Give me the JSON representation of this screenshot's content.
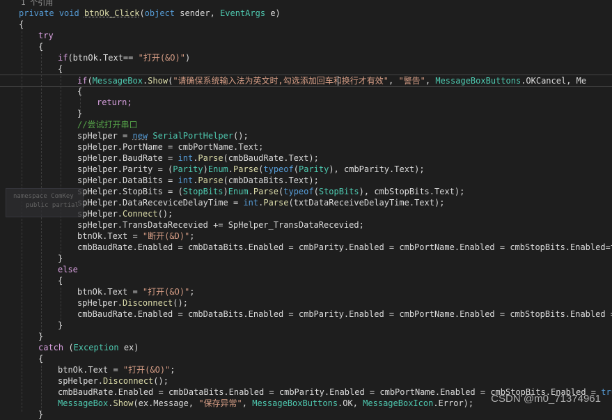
{
  "editor": {
    "codelens": "1 个引用",
    "sig": {
      "kw1": "private",
      "kw2": "void",
      "name": "btnOk_Click",
      "p1": "(",
      "t1": "object",
      "p2": " sender, ",
      "t2": "EventArgs",
      "p3": " e)"
    },
    "ob1": "{",
    "try": "try",
    "ob2": "{",
    "if1": {
      "kw": "if",
      "a": "(btnOk.Text== ",
      "s": "\"打开(&O)\"",
      "b": ")"
    },
    "ob3": "{",
    "if2": {
      "kw": "if",
      "a": "(",
      "cls": "MessageBox",
      "dot": ".",
      "m": "Show",
      "b": "(",
      "s1": "\"请确保系统输入法为英文时,勾选添加回车和换行才有效\"",
      "c": ", ",
      "s2": "\"警告\"",
      "d": ", ",
      "cls2": "MessageBoxButtons",
      "e": ".OKCancel, Me"
    },
    "ob4": "{",
    "ret": "return;",
    "cb4": "}",
    "comment": "//尝试打开串口",
    "l1": {
      "a": "spHelper = ",
      "kw": "new",
      "sp": " ",
      "cls": "SerialPortHelper",
      "b": "();"
    },
    "l2": "spHelper.PortName = cmbPortName.Text;",
    "l3": {
      "a": "spHelper.BaudRate = ",
      "kw": "int",
      "dot": ".",
      "m": "Parse",
      "b": "(cmbBaudRate.Text);"
    },
    "l4": {
      "a": "spHelper.Parity = (",
      "t": "Parity",
      ")": ")",
      "cls": "Enum",
      "dot": ".",
      "m": "Parse",
      "b": "(",
      "kw": "typeof",
      "c": "(",
      "t2": "Parity",
      "d": "), cmbParity.Text);"
    },
    "l5": {
      "a": "spHelper.DataBits = ",
      "kw": "int",
      "dot": ".",
      "m": "Parse",
      "b": "(cmbDataBits.Text);"
    },
    "l6": {
      "a": "spHelper.StopBits = (",
      "t": "StopBits",
      ")": ")",
      "cls": "Enum",
      "dot": ".",
      "m": "Parse",
      "b": "(",
      "kw": "typeof",
      "c": "(",
      "t2": "StopBits",
      "d": "), cmbStopBits.Text);"
    },
    "l7": {
      "a": "spHelper.DataReceviceDelayTime = ",
      "kw": "int",
      "dot": ".",
      "m": "Parse",
      "b": "(txtDataReceiveDelayTime.Text);"
    },
    "l8": {
      "a": "spHelper.",
      "m": "Connect",
      "b": "();"
    },
    "l9": "spHelper.TransDataRecevied += SpHelper_TransDataRecevied;",
    "l10": {
      "a": "btnOk.Text = ",
      "s": "\"断开(&D)\"",
      "b": ";"
    },
    "l11": "cmbBaudRate.Enabled = cmbDataBits.Enabled = cmbParity.Enabled = cmbPortName.Enabled = cmbStopBits.Enabled=txtD",
    "cb3": "}",
    "else": "else",
    "ob5": "{",
    "e1": {
      "a": "btnOk.Text = ",
      "s": "\"打开(&O)\"",
      "b": ";"
    },
    "e2": {
      "a": "spHelper.",
      "m": "Disconnect",
      "b": "();"
    },
    "e3": "cmbBaudRate.Enabled = cmbDataBits.Enabled = cmbParity.Enabled = cmbPortName.Enabled = cmbStopBits.Enabled = txtD",
    "cb5": "}",
    "cb2": "}",
    "catch": {
      "kw": "catch",
      "a": " (",
      "t": "Exception",
      "b": " ex)"
    },
    "ob6": "{",
    "c1": {
      "a": "btnOk.Text = ",
      "s": "\"打开(&O)\"",
      "b": ";"
    },
    "c2": {
      "a": "spHelper.",
      "m": "Disconnect",
      "b": "();"
    },
    "c3": {
      "a": "cmbBaudRate.Enabled = cmbDataBits.Enabled = cmbParity.Enabled = cmbPortName.Enabled = cmbStopBits.Enabled = ",
      "kw": "true",
      "b": ";"
    },
    "c4": {
      "cls": "MessageBox",
      "dot": ".",
      "m": "Show",
      "a": "(ex.Message, ",
      "s": "\"保存异常\"",
      "b": ", ",
      "cls2": "MessageBoxButtons",
      "c": ".OK, ",
      "cls3": "MessageBoxIcon",
      "d": ".Error);"
    }
  },
  "peek": {
    "line1": "namespace ComKey",
    "line2": "public partial"
  },
  "watermark": "CSDN @m0_71374961",
  "colors": {
    "background": "#1e1e1e",
    "keyword": "#569cd6",
    "control": "#d8a0df",
    "type": "#4ec9b0",
    "string": "#d69d85",
    "comment": "#57a64a",
    "method": "#dcdcaa"
  }
}
